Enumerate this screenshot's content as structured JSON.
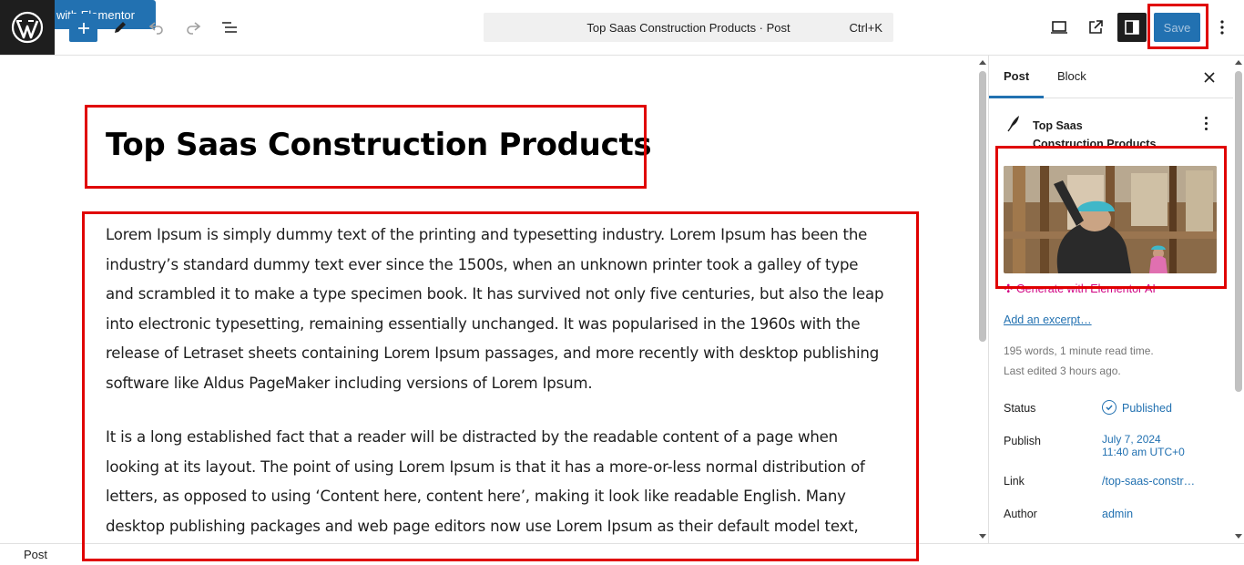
{
  "toolbar": {
    "add_block_icon": "plus-icon",
    "tools_icon": "pencil-icon",
    "undo_icon": "undo-icon",
    "redo_icon": "redo-icon",
    "list_view_icon": "list-view-icon",
    "elementor_label": "Edit with Elementor",
    "command_title": "Top Saas Construction Products · Post",
    "command_shortcut": "Ctrl+K",
    "view_icon": "desktop-icon",
    "preview_icon": "external-link-icon",
    "settings_icon": "sidebar-icon",
    "save_label": "Save",
    "options_icon": "kebab-icon"
  },
  "editor": {
    "title": "Top Saas Construction Products",
    "paragraphs": [
      "Lorem Ipsum is simply dummy text of the printing and typesetting industry. Lorem Ipsum has been the industry’s standard dummy text ever since the 1500s, when an unknown printer took a galley of type and scrambled it to make a type specimen book. It has survived not only five centuries, but also the leap into electronic typesetting, remaining essentially unchanged. It was popularised in the 1960s with the release of Letraset sheets containing Lorem Ipsum passages, and more recently with desktop publishing software like Aldus PageMaker including versions of Lorem Ipsum.",
      "It is a long established fact that a reader will be distracted by the readable content of a page when looking at its layout. The point of using Lorem Ipsum is that it has a more-or-less normal distribution of letters, as opposed to using ‘Content here, content here’, making it look like readable English. Many desktop publishing packages and web page editors now use Lorem Ipsum as their default model text,"
    ]
  },
  "sidebar": {
    "tabs": [
      {
        "label": "Post",
        "active": true
      },
      {
        "label": "Block",
        "active": false
      }
    ],
    "post_title_lines": [
      "Top Saas",
      "Construction Products"
    ],
    "generate_ai": "Generate with Elementor AI",
    "add_excerpt": "Add an excerpt…",
    "word_count": "195 words, 1 minute read time.",
    "last_edited": "Last edited 3 hours ago.",
    "rows": [
      {
        "label": "Status",
        "value": "Published"
      },
      {
        "label": "Publish",
        "value_line1": "July 7, 2024",
        "value_line2": "11:40 am UTC+0"
      },
      {
        "label": "Link",
        "value": "/top-saas-constr…"
      },
      {
        "label": "Author",
        "value": "admin"
      }
    ]
  },
  "footer": {
    "breadcrumb": "Post"
  },
  "colors": {
    "accent": "#2271b1",
    "highlight": "#e00000",
    "ai_pink": "#d10082"
  }
}
